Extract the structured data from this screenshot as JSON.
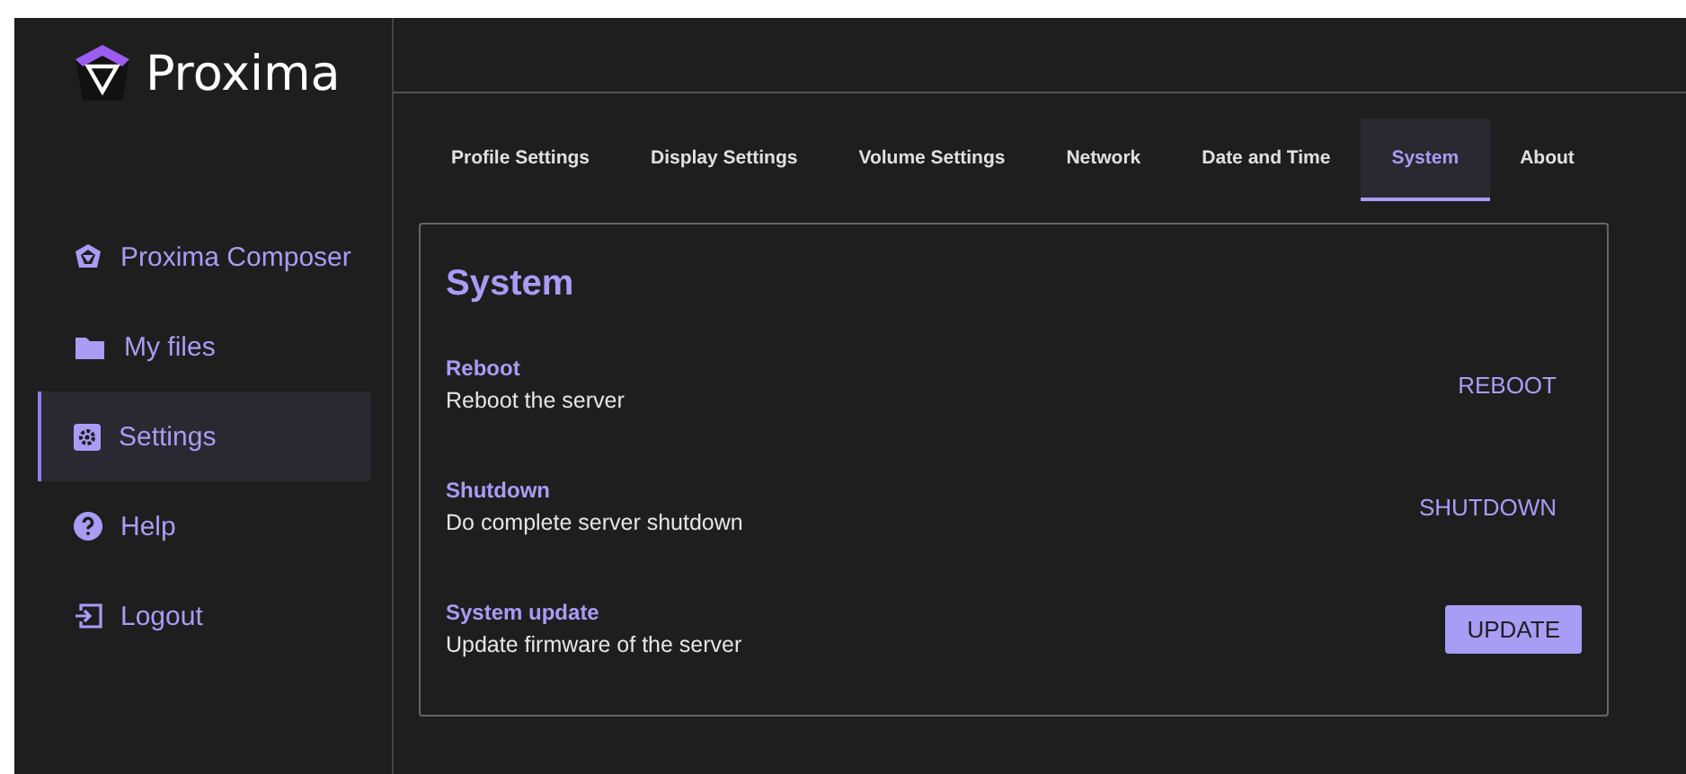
{
  "logo": {
    "text": "Proxima"
  },
  "sidebar": {
    "items": [
      {
        "label": "Proxima Composer",
        "kind": "gem",
        "selected": false
      },
      {
        "label": "My files",
        "kind": "folder",
        "selected": false
      },
      {
        "label": "Settings",
        "kind": "gear",
        "selected": true
      },
      {
        "label": "Help",
        "kind": "help",
        "selected": false
      },
      {
        "label": "Logout",
        "kind": "logout",
        "selected": false
      }
    ]
  },
  "tabs": [
    {
      "label": "Profile Settings",
      "selected": false
    },
    {
      "label": "Display Settings",
      "selected": false
    },
    {
      "label": "Volume Settings",
      "selected": false
    },
    {
      "label": "Network",
      "selected": false
    },
    {
      "label": "Date and Time",
      "selected": false
    },
    {
      "label": "System",
      "selected": true
    },
    {
      "label": "About",
      "selected": false
    }
  ],
  "panel": {
    "title": "System",
    "rows": [
      {
        "title": "Reboot",
        "description": "Reboot the server",
        "button": {
          "label": "REBOOT",
          "kind": "text"
        }
      },
      {
        "title": "Shutdown",
        "description": "Do complete server shutdown",
        "button": {
          "label": "SHUTDOWN",
          "kind": "text"
        }
      },
      {
        "title": "System update",
        "description": "Update firmware of the server",
        "button": {
          "label": "UPDATE",
          "kind": "contained"
        }
      }
    ]
  }
}
